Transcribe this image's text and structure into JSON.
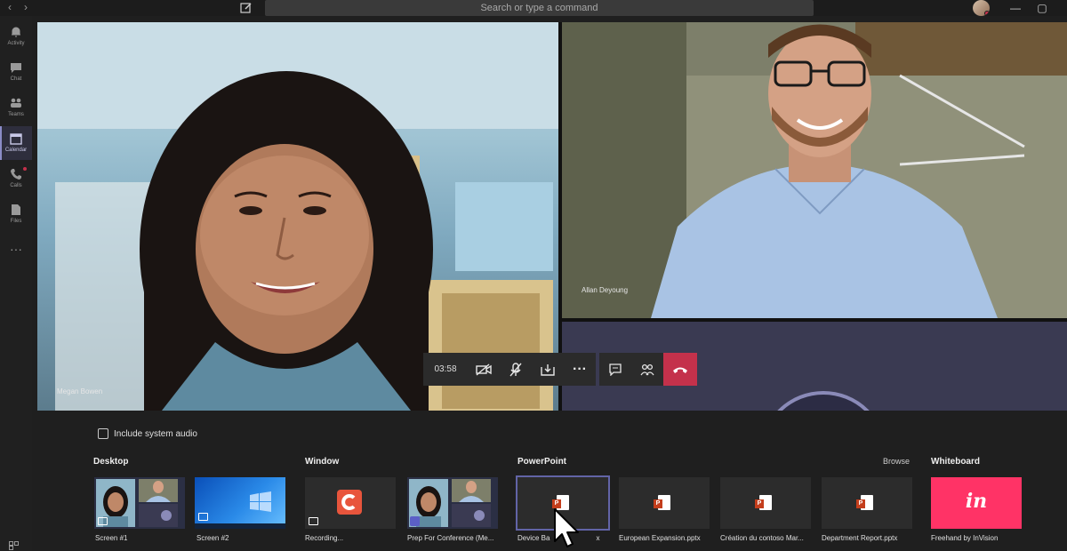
{
  "topbar": {
    "search_placeholder": "Search or type a command",
    "back_icon": "chevron-left-icon",
    "forward_icon": "chevron-right-icon",
    "compose_icon": "compose-icon"
  },
  "rail": {
    "items": [
      {
        "label": "Activity",
        "icon": "bell-icon"
      },
      {
        "label": "Chat",
        "icon": "chat-icon"
      },
      {
        "label": "Teams",
        "icon": "teams-icon"
      },
      {
        "label": "Calendar",
        "icon": "calendar-icon",
        "active": true
      },
      {
        "label": "Calls",
        "icon": "phone-icon"
      },
      {
        "label": "Files",
        "icon": "files-icon"
      }
    ]
  },
  "participants": {
    "left": "Megan Bowen",
    "right": "Allan Deyoung"
  },
  "call": {
    "duration": "03:58"
  },
  "tray": {
    "include_audio": "Include system audio",
    "sections": {
      "desktop": "Desktop",
      "window": "Window",
      "powerpoint": "PowerPoint",
      "browse": "Browse",
      "whiteboard": "Whiteboard"
    },
    "items": {
      "screen1": "Screen #1",
      "screen2": "Screen #2",
      "recording": "Recording...",
      "prep": "Prep For Conference (Me...",
      "device": "Device Ba",
      "device_tail": "x",
      "european": "European Expansion.pptx",
      "creation": "Création du contoso Mar...",
      "department": "Department Report.pptx",
      "freehand": "Freehand by InVision",
      "invision_logo": "in"
    }
  },
  "colors": {
    "accent": "#6264a7",
    "hangup": "#c4314b",
    "ppt_orange": "#c43e1c",
    "invision_pink": "#ff3366"
  }
}
